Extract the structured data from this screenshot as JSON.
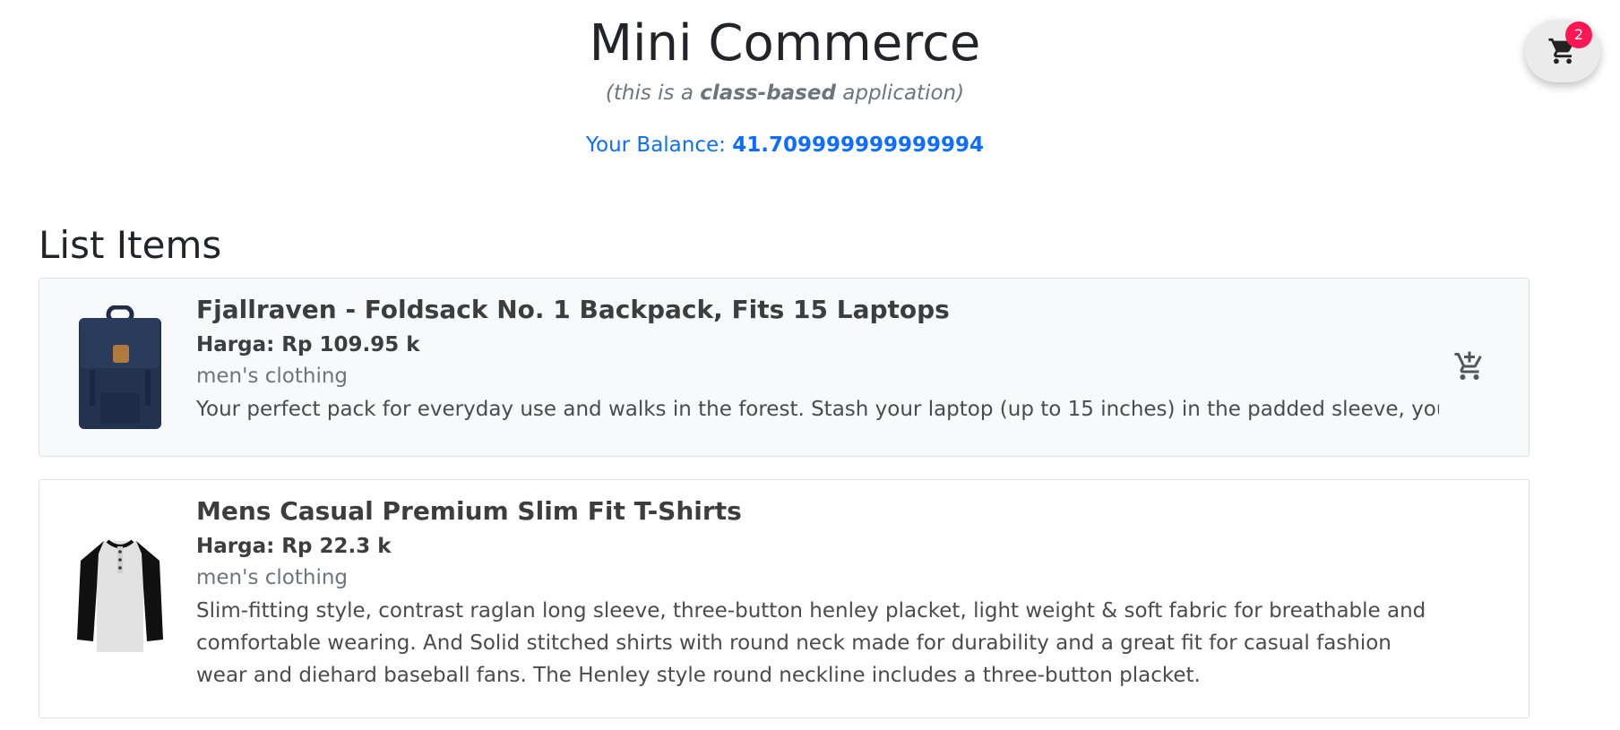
{
  "header": {
    "title": "Mini Commerce",
    "subtitle_prefix": "(this is a ",
    "subtitle_bold": "class-based",
    "subtitle_suffix": " application)",
    "balance_label": "Your Balance: ",
    "balance_value": "41.709999999999994"
  },
  "cart": {
    "icon": "shopping-cart-icon",
    "count": "2",
    "badge_color": "#ff1654"
  },
  "section_title": "List Items",
  "items": [
    {
      "title": "Fjallraven - Foldsack No. 1 Backpack, Fits 15 Laptops",
      "price": "Harga: Rp 109.95 k",
      "category": "men's clothing",
      "description": "Your perfect pack for everyday use and walks in the forest. Stash your laptop (up to 15 inches) in the padded sleeve, your everyday",
      "action_icon": "add-to-cart-icon"
    },
    {
      "title": "Mens Casual Premium Slim Fit T-Shirts",
      "price": "Harga: Rp 22.3 k",
      "category": "men's clothing",
      "description": "Slim-fitting style, contrast raglan long sleeve, three-button henley placket, light weight & soft fabric for breathable and comfortable wearing. And Solid stitched shirts with round neck made for durability and a great fit for casual fashion wear and diehard baseball fans. The Henley style round neckline includes a three-button placket."
    }
  ],
  "colors": {
    "accent": "#0d6efd",
    "card_active_bg": "#f8f9fa",
    "border": "#dee2e6"
  }
}
